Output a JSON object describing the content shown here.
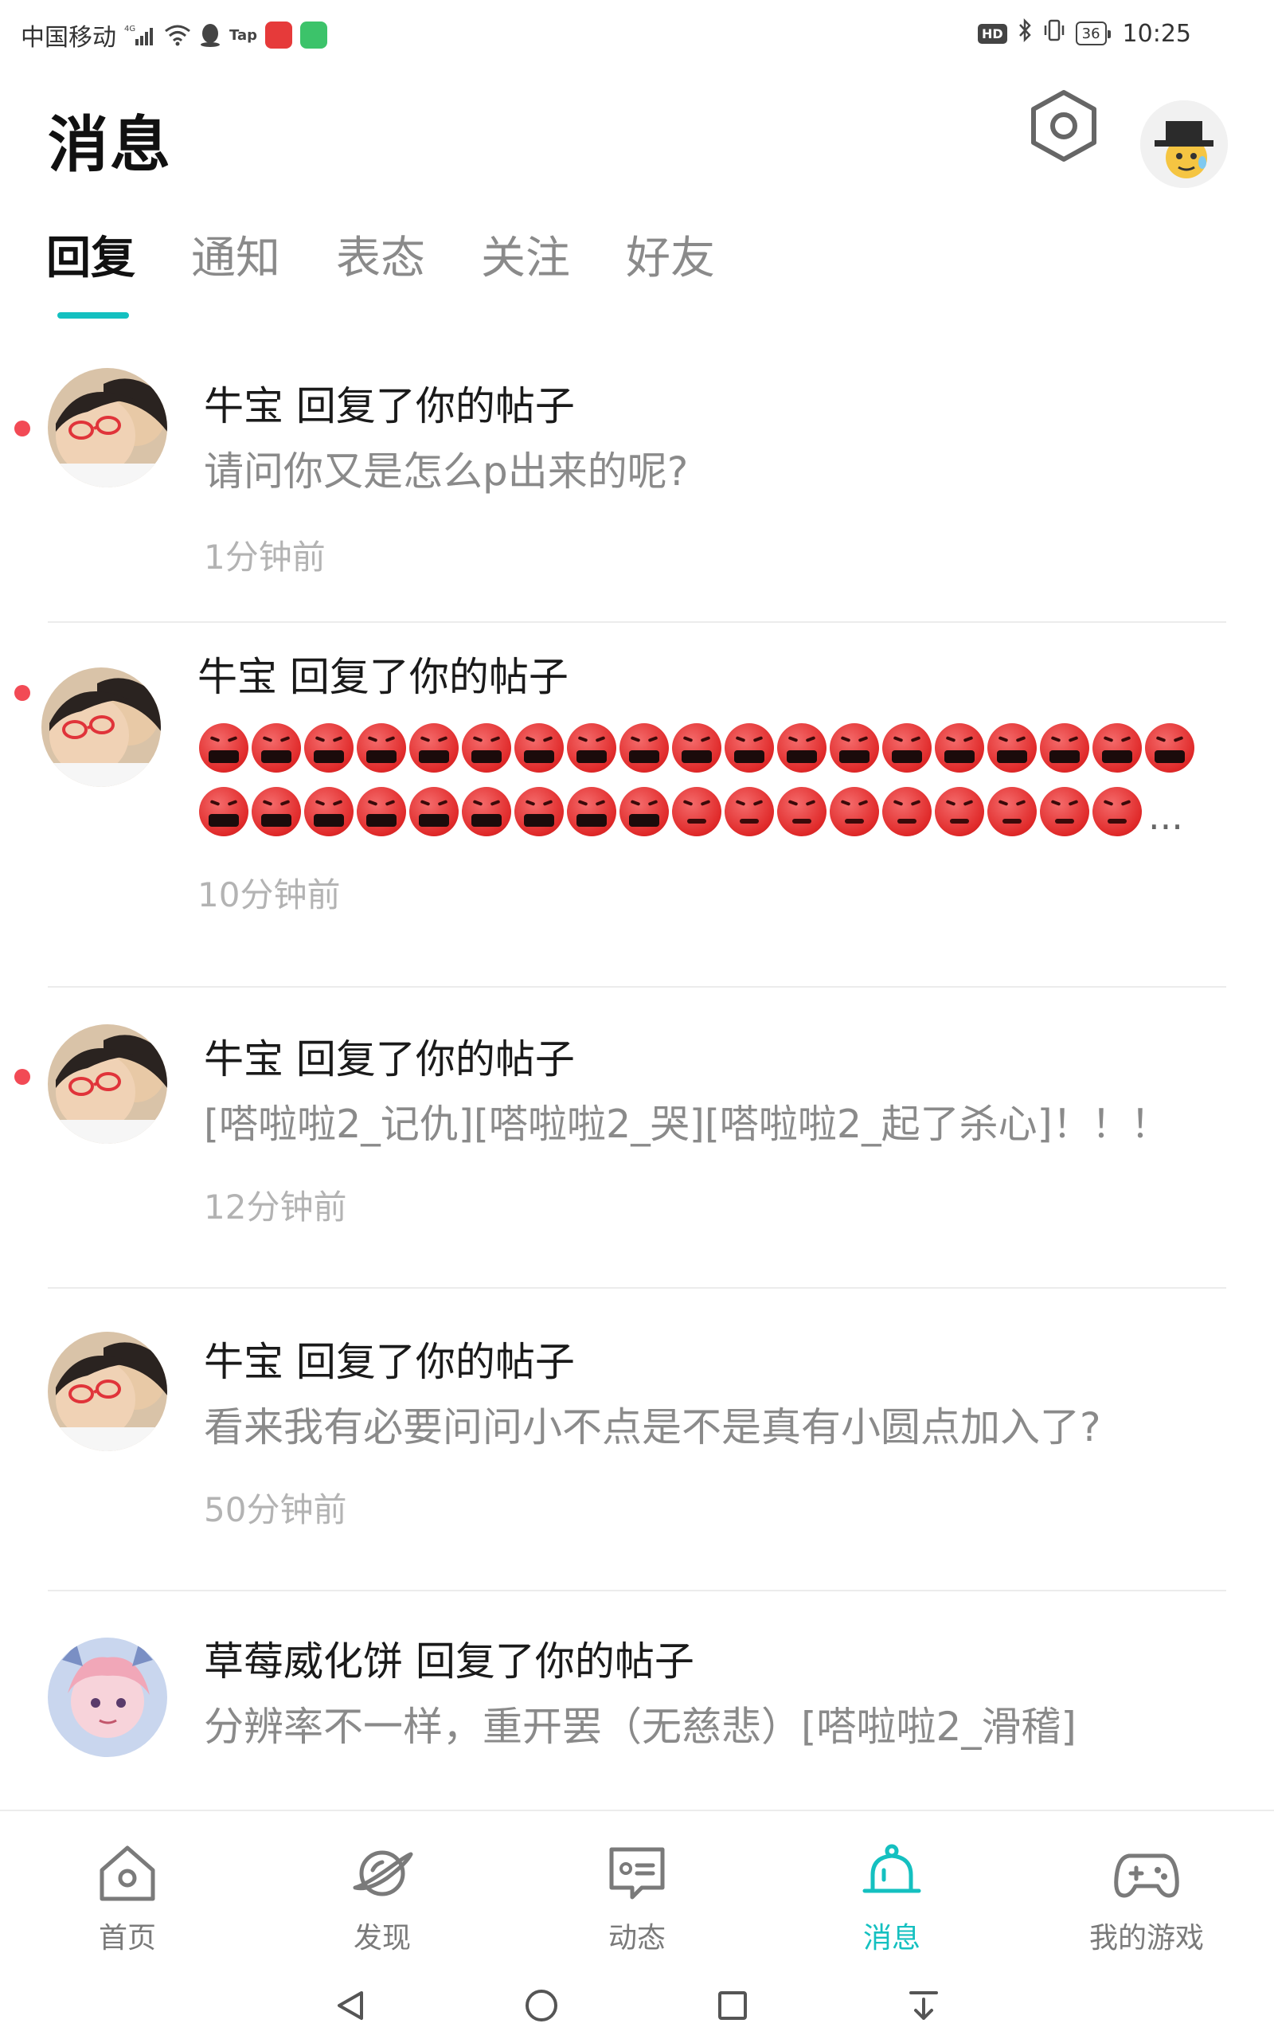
{
  "status_bar": {
    "carrier": "中国移动",
    "network": "4G",
    "time": "10:25",
    "battery": "36",
    "hd": "HD",
    "tap_label": "Tap"
  },
  "header": {
    "title": "消息"
  },
  "tabs": [
    {
      "label": "回复",
      "active": true
    },
    {
      "label": "通知",
      "active": false
    },
    {
      "label": "表态",
      "active": false
    },
    {
      "label": "关注",
      "active": false
    },
    {
      "label": "好友",
      "active": false
    }
  ],
  "messages": [
    {
      "title": "牛宝 回复了你的帖子",
      "content": "请问你又是怎么p出来的呢?",
      "time": "1分钟前",
      "unread": true
    },
    {
      "title": "牛宝 回复了你的帖子",
      "content_type": "emoji",
      "time": "10分钟前",
      "unread": true,
      "ellipsis": "..."
    },
    {
      "title": "牛宝 回复了你的帖子",
      "content": "[嗒啦啦2_记仇][嗒啦啦2_哭][嗒啦啦2_起了杀心]！！！",
      "time": "12分钟前",
      "unread": true
    },
    {
      "title": "牛宝 回复了你的帖子",
      "content": "看来我有必要问问小不点是不是真有小圆点加入了?",
      "time": "50分钟前",
      "unread": false
    },
    {
      "title": "草莓威化饼 回复了你的帖子",
      "content": "分辨率不一样，重开罢（无慈悲）[嗒啦啦2_滑稽]",
      "time": "",
      "unread": false
    }
  ],
  "bottom_nav": [
    {
      "label": "首页",
      "icon": "home-icon",
      "active": false
    },
    {
      "label": "发现",
      "icon": "planet-icon",
      "active": false
    },
    {
      "label": "动态",
      "icon": "feed-icon",
      "active": false
    },
    {
      "label": "消息",
      "icon": "bell-icon",
      "active": true
    },
    {
      "label": "我的游戏",
      "icon": "gamepad-icon",
      "active": false
    }
  ],
  "colors": {
    "accent": "#14c0c0",
    "unread_dot": "#f24a55",
    "muted_text": "#8a8a8a"
  }
}
